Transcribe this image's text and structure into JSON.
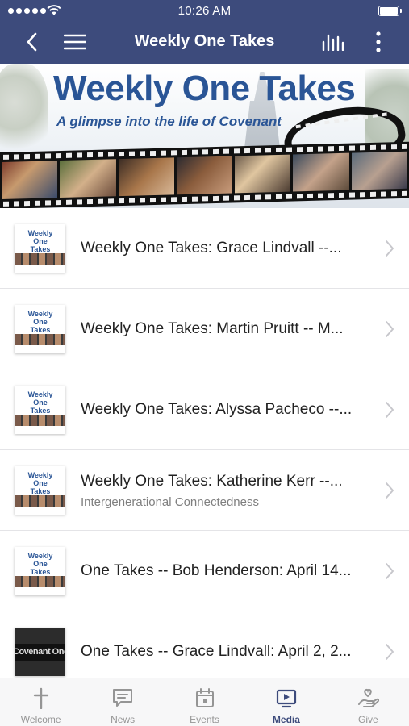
{
  "status_bar": {
    "time": "10:26 AM",
    "signal_icon": "signal-dots-icon",
    "wifi_icon": "wifi-icon",
    "battery_icon": "battery-icon"
  },
  "nav": {
    "title": "Weekly One Takes",
    "back_icon": "chevron-left-icon",
    "menu_icon": "hamburger-icon",
    "audio_icon": "equalizer-bars-icon",
    "more_icon": "more-vertical-icon",
    "background": "#3d4b7c"
  },
  "banner": {
    "heading": "Weekly One Takes",
    "subheading": "A glimpse into the life of Covenant",
    "accent": "#2a5596"
  },
  "items": [
    {
      "title": "Weekly One Takes: Grace Lindvall --...",
      "subtitle": "",
      "thumb_text": "Weekly One Takes",
      "thumb_style": "weekly"
    },
    {
      "title": "Weekly One Takes: Martin Pruitt -- M...",
      "subtitle": "",
      "thumb_text": "Weekly One Takes",
      "thumb_style": "weekly"
    },
    {
      "title": "Weekly One Takes: Alyssa Pacheco --...",
      "subtitle": "",
      "thumb_text": "Weekly One Takes",
      "thumb_style": "weekly"
    },
    {
      "title": "Weekly One Takes: Katherine Kerr --...",
      "subtitle": "Intergenerational Connectedness",
      "thumb_text": "Weekly One Takes",
      "thumb_style": "weekly"
    },
    {
      "title": "One Takes -- Bob Henderson: April 14...",
      "subtitle": "",
      "thumb_text": "Weekly One Takes",
      "thumb_style": "weekly"
    },
    {
      "title": "One Takes -- Grace Lindvall: April 2, 2...",
      "subtitle": "",
      "thumb_text": "Covenant One Take",
      "thumb_style": "dark"
    }
  ],
  "tabs": [
    {
      "label": "Welcome",
      "icon": "cross-icon",
      "active": false
    },
    {
      "label": "News",
      "icon": "chat-bubble-icon",
      "active": false
    },
    {
      "label": "Events",
      "icon": "calendar-icon",
      "active": false
    },
    {
      "label": "Media",
      "icon": "play-screen-icon",
      "active": true
    },
    {
      "label": "Give",
      "icon": "hand-heart-icon",
      "active": false
    }
  ],
  "colors": {
    "active_tab": "#3d4b7c",
    "inactive_tab": "#959595"
  }
}
